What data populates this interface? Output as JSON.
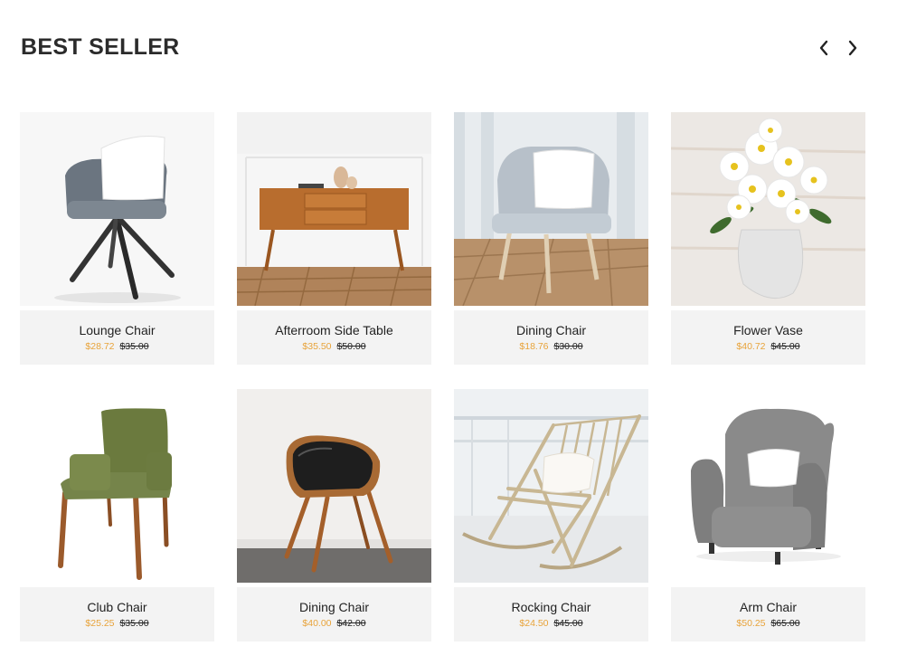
{
  "section": {
    "title": "BEST SELLER"
  },
  "nav": {
    "prev_icon": "chevron-left-icon",
    "next_icon": "chevron-right-icon"
  },
  "colors": {
    "sale_price": "#e8a33a",
    "info_bg": "#f3f3f3",
    "title": "#2b2b2b"
  },
  "products": [
    {
      "name": "Lounge Chair",
      "price": "$28.72",
      "old_price": "$35.00",
      "image": "grey lounge chair with pillow"
    },
    {
      "name": "Afterroom Side Table",
      "price": "$35.50",
      "old_price": "$50.00",
      "image": "wooden side table with vases"
    },
    {
      "name": "Dining Chair",
      "price": "$18.76",
      "old_price": "$30.00",
      "image": "light blue chair with pillow"
    },
    {
      "name": "Flower Vase",
      "price": "$40.72",
      "old_price": "$45.00",
      "image": "white vase with daisies"
    },
    {
      "name": "Club Chair",
      "price": "$25.25",
      "old_price": "$35.00",
      "image": "green upholstered chair"
    },
    {
      "name": "Dining Chair",
      "price": "$40.00",
      "old_price": "$42.00",
      "image": "black leather and wood chair"
    },
    {
      "name": "Rocking Chair",
      "price": "$24.50",
      "old_price": "$45.00",
      "image": "wooden rocking chair"
    },
    {
      "name": "Arm Chair",
      "price": "$50.25",
      "old_price": "$65.00",
      "image": "grey wingback arm chair"
    }
  ]
}
